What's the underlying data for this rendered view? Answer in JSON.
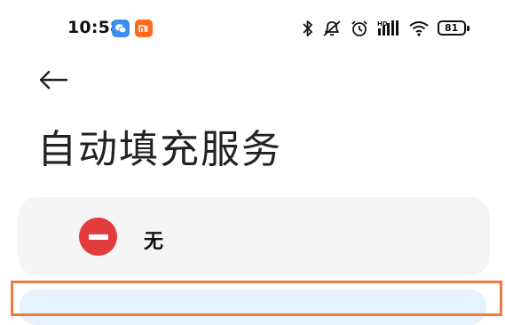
{
  "status_bar": {
    "time": "10:58",
    "battery_level": "81",
    "icons": [
      "wechat-notification-icon",
      "mi-notification-icon",
      "bluetooth-icon",
      "mute-icon",
      "alarm-icon",
      "hd-signal-icon",
      "wifi-icon",
      "battery-icon"
    ]
  },
  "header": {
    "back_icon": "arrow-left-icon",
    "title": "自动填充服务"
  },
  "options": [
    {
      "label": "无",
      "icon": "minus-circle-icon",
      "icon_color": "#e23b3b"
    }
  ],
  "colors": {
    "card_bg": "#f5f5f5",
    "selected_bg": "#e6f3ff",
    "highlight_border": "#ee7a3e"
  }
}
